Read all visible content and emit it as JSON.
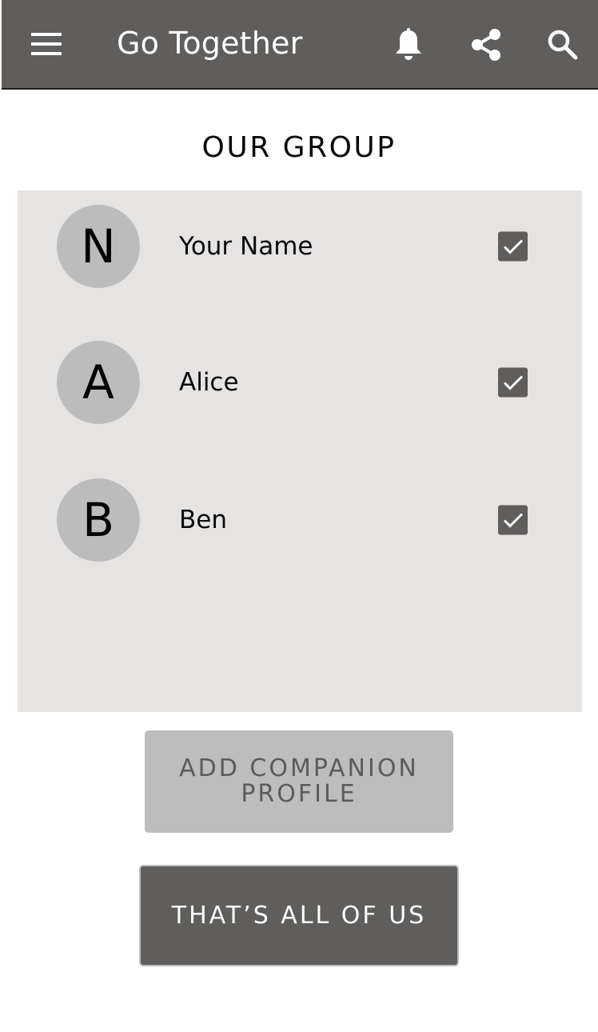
{
  "app_bar": {
    "title": "Go Together",
    "menu_icon": "menu-icon",
    "notification_icon": "bell-icon",
    "share_icon": "share-icon",
    "search_icon": "search-icon",
    "background": "#5f5e5d"
  },
  "section": {
    "title": "OUR GROUP"
  },
  "group": {
    "members": [
      {
        "initial": "N",
        "name": "Your Name",
        "checked": true
      },
      {
        "initial": "A",
        "name": "Alice",
        "checked": true
      },
      {
        "initial": "B",
        "name": "Ben",
        "checked": true
      }
    ]
  },
  "actions": {
    "add_companion_label": "ADD COMPANION PROFILE",
    "done_label": "THAT’S ALL OF US"
  },
  "colors": {
    "panel": "#e6e3e3",
    "avatar": "#bcbcbc",
    "checkbox": "#5f5e5d",
    "secondary_button": "#bdbdbd",
    "primary_button": "#5f5e5d"
  }
}
